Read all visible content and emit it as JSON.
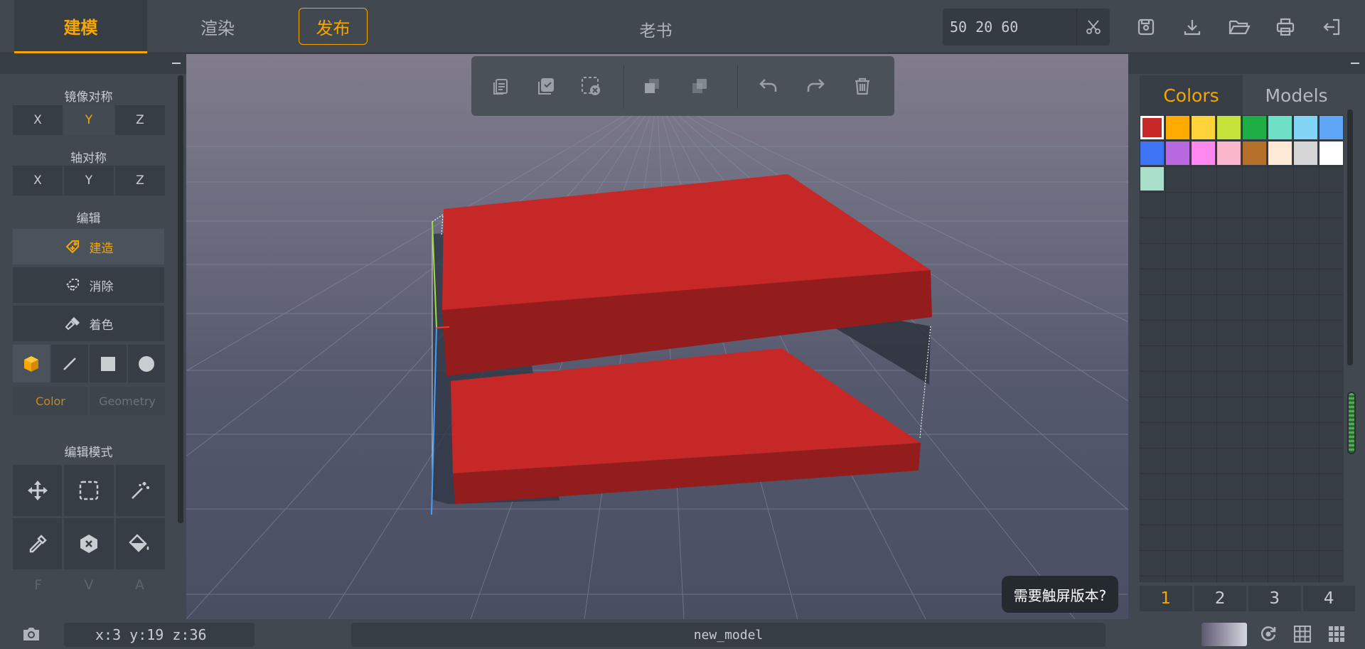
{
  "topbar": {
    "tabs": [
      {
        "label": "建模",
        "active": true
      },
      {
        "label": "渲染",
        "active": false
      }
    ],
    "publish_label": "发布",
    "title": "老书",
    "dimensions_value": "50 20 60",
    "icons": [
      "save-icon",
      "download-icon",
      "open-folder-icon",
      "print-icon",
      "exit-icon"
    ]
  },
  "left_panel": {
    "mirror_title": "镜像对称",
    "mirror_axes": [
      "X",
      "Y",
      "Z"
    ],
    "mirror_active": "Y",
    "axis_title": "轴对称",
    "axis_axes": [
      "X",
      "Y",
      "Z"
    ],
    "edit_title": "编辑",
    "edit_buttons": [
      {
        "label": "建造",
        "icon": "build-icon",
        "active": true
      },
      {
        "label": "消除",
        "icon": "erase-icon",
        "active": false
      },
      {
        "label": "着色",
        "icon": "paint-icon",
        "active": false
      }
    ],
    "shapes": [
      "cube-icon",
      "line-icon",
      "square-icon",
      "circle-icon"
    ],
    "subtabs": [
      {
        "label": "Color",
        "active": true
      },
      {
        "label": "Geometry",
        "active": false
      }
    ],
    "mode_title": "编辑模式",
    "modes": [
      "move-icon",
      "select-box-icon",
      "magic-wand-icon",
      "eyedropper-icon",
      "delete-hex-icon",
      "fill-bucket-icon"
    ],
    "fva": [
      "F",
      "V",
      "A"
    ]
  },
  "edit_toolbar": {
    "icons": [
      "copy-icon",
      "paste-icon",
      "clear-selection-icon",
      "bring-front-icon",
      "send-back-icon",
      "undo-icon",
      "redo-icon",
      "trash-icon"
    ]
  },
  "touch_tip": "需要触屏版本?",
  "right_panel": {
    "tabs": [
      {
        "label": "Colors",
        "active": true
      },
      {
        "label": "Models",
        "active": false
      }
    ],
    "colors": [
      "#c62828",
      "#ffab00",
      "#ffd43b",
      "#c5e33a",
      "#1fae45",
      "#6fe0c6",
      "#82d4f4",
      "#5fa6f7",
      "#3d74f5",
      "#b868de",
      "#ff88ee",
      "#f9b5c9",
      "#b5712a",
      "#fde9d5",
      "#d5d5d5",
      "#ffffff",
      "#a7dfcb"
    ],
    "selected_color": "#c62828",
    "pages": [
      "1",
      "2",
      "3",
      "4"
    ],
    "active_page": "1"
  },
  "bottombar": {
    "coords": "x:3 y:19 z:36",
    "model_name": "new_model",
    "icons": [
      "camera-icon",
      "reset-view-icon",
      "grid-icon",
      "grid-dense-icon"
    ]
  },
  "colors": {
    "accent": "#f7a600",
    "model_red": "#c62828",
    "panel": "#414850"
  }
}
